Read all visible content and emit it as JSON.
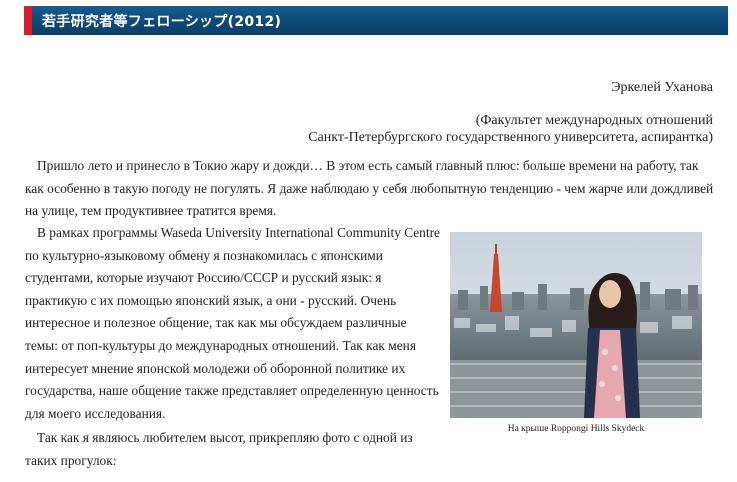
{
  "header": {
    "title": "若手研究者等フェローシップ(2012)"
  },
  "author": {
    "name": "Эркелей Уханова"
  },
  "affiliation": {
    "line1": "(Факультет международных отношений",
    "line2": "Санкт-Петербургского государственного университета, аспирантка)"
  },
  "body": {
    "p1": "Пришло лето и принесло в Токио жару и дожди… В этом есть самый главный плюс: больше времени на работу, так как особенно в такую погоду не погулять. Я даже наблюдаю у себя любопытную тенденцию - чем жарче или дождливей на улице, тем продуктивнее тратится время.",
    "p2": "В рамках программы Waseda University International Community Centre по культурно-языковому обмену я познакомилась с японскими студентами, которые изучают Россию/СССР и русский язык: я практикую с их помощью японский язык, а они - русский. Очень интересное и полезное общение, так как мы обсуждаем различные темы: от поп-культуры до международных отношений. Так как меня интересует мнение японской молодежи об оборонной политике их государства, наше общение также представляет определенную ценность для моего исследования.",
    "p3": "Так как я являюсь любителем высот, прикрепляю фото с одной из таких прогулок:"
  },
  "photo": {
    "caption": "На крыше Roppongi Hills Skydeck"
  }
}
